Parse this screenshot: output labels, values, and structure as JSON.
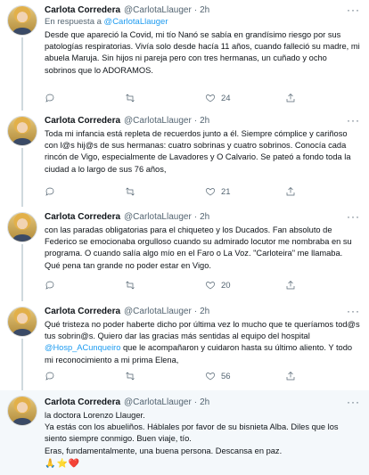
{
  "tweets": [
    {
      "name": "Carlota Corredera",
      "handle": "@CarlotaLlauger",
      "dot": "·",
      "time": "2h",
      "reply_prefix": "En respuesta a",
      "reply_mention": "@CarlotaLlauger",
      "text": "Desde que apareció la Covid, mi tío Nanó se sabía en grandísimo riesgo por sus patologías respiratorias. Vivía solo desde hacía 11 años, cuando falleció su madre, mi abuela Maruja. Sin hijos ni pareja pero con tres hermanas, un cuñado y ocho sobrinos que lo ADORAMOS.",
      "likes": "24"
    },
    {
      "name": "Carlota Corredera",
      "handle": "@CarlotaLlauger",
      "dot": "·",
      "time": "2h",
      "text": "Toda mi infancia está repleta de recuerdos junto a él. Siempre cómplice y cariñoso con l@s hij@s de sus hermanas: cuatro sobrinas y cuatro sobrinos. Conocía cada rincón de Vigo, especialmente de Lavadores y O Calvario. Se pateó a fondo toda la ciudad a lo largo de sus 76 años,",
      "likes": "21"
    },
    {
      "name": "Carlota Corredera",
      "handle": "@CarlotaLlauger",
      "dot": "·",
      "time": "2h",
      "text": "con las paradas obligatorias para el chiqueteo y los Ducados. Fan absoluto de Federico se emocionaba orgulloso cuando su admirado locutor me nombraba en su programa. O cuando salía algo mío en el Faro o La Voz. \"Carloteira\" me llamaba. Qué pena tan grande no poder estar en Vigo.",
      "likes": "20"
    },
    {
      "name": "Carlota Corredera",
      "handle": "@CarlotaLlauger",
      "dot": "·",
      "time": "2h",
      "text_before": "Qué tristeza no poder haberte dicho por última vez lo mucho que te queríamos tod@s tus sobrin@s. Quiero dar las gracias más sentidas al equipo del hospital ",
      "text_mention": "@Hosp_ACunqueiro",
      "text_after": " que le acompañaron y cuidaron hasta su último aliento. Y todo mi reconocimiento a mi prima Elena,",
      "likes": "56"
    },
    {
      "name": "Carlota Corredera",
      "handle": "@CarlotaLlauger",
      "dot": "·",
      "time": "2h",
      "line1": "la doctora Lorenzo Llauger.",
      "line2": "Ya estás con los abueliños. Háblales por favor de su bisnieta Alba. Diles que los siento siempre conmigo. Buen viaje, tío.",
      "line3": "Eras, fundamentalmente, una buena persona. Descansa en paz.",
      "emojis": [
        "🙏",
        "⭐",
        "❤️"
      ]
    }
  ],
  "more_icon": "···",
  "icons": {
    "reply": "reply-icon",
    "retweet": "retweet-icon",
    "like": "heart-icon",
    "share": "share-icon"
  }
}
